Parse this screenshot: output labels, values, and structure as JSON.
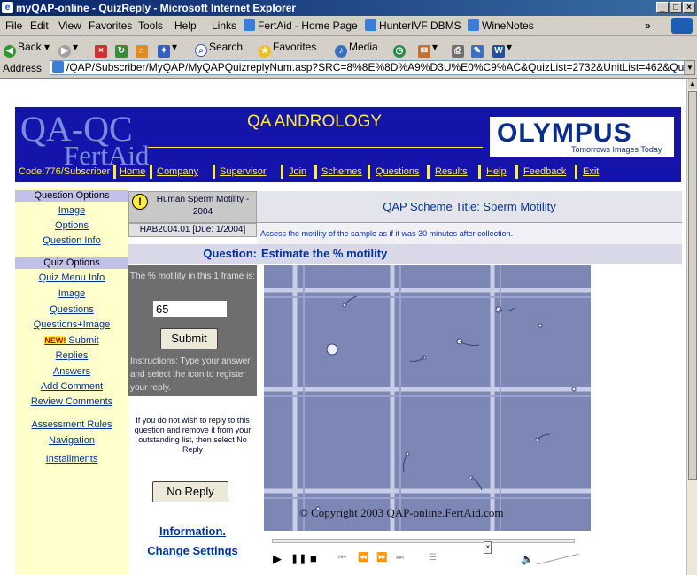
{
  "window": {
    "title": "myQAP-online - QuizReply - Microsoft Internet Explorer",
    "buttons": [
      "_",
      "□",
      "×"
    ]
  },
  "menu": {
    "items": [
      "File",
      "Edit",
      "View",
      "Favorites",
      "Tools",
      "Help"
    ],
    "links_label": "Links",
    "links": [
      "FertAid - Home Page",
      "HunterIVF DBMS",
      "WineNotes"
    ],
    "chevron": "»"
  },
  "toolbar": {
    "back": "Back",
    "search": "Search",
    "favorites": "Favorites",
    "media": "Media"
  },
  "address": {
    "label": "Address",
    "url": "/QAP/Subscriber/MyQAP/MyQAPQuizreplyNum.asp?SRC=8%8E%8D%A9%D3U%E0%C9%AC&QuizList=2732&UnitList=462&QuestList=56"
  },
  "header": {
    "logo_top": "QA-QC",
    "logo_bottom": "FertAid",
    "title": "QA ANDROLOGY",
    "sponsor_name": "OLYMPUS",
    "sponsor_tagline": "Tomorrows Images Today",
    "code": "Code:776/Subscriber",
    "nav": [
      "Home",
      "Company",
      "Supervisor",
      "Join",
      "Schemes",
      "Questions",
      "Results",
      "Help",
      "Feedback",
      "Exit"
    ]
  },
  "sidebar": {
    "question_options_header": "Question Options",
    "question_options": [
      "Image",
      "Options",
      "Question Info"
    ],
    "quiz_options_header": "Quiz Options",
    "quiz_options": [
      "Quiz Menu Info",
      "Image",
      "Questions",
      "Questions+Image"
    ],
    "new_badge": "NEW!",
    "quiz_options_2": [
      "Submit",
      "Replies",
      "Answers",
      "Add Comment",
      "Review Comments"
    ],
    "bottom_links": [
      "Assessment Rules",
      "Navigation",
      "Installments"
    ]
  },
  "question": {
    "topic": "Human Sperm Motility - 2004",
    "ref": "HAB2004.01 [Due: 1/2004]",
    "scheme_title": "QAP Scheme Title: Sperm Motility",
    "instruction": "Assess the motility of the sample as if it was 30 minutes after collection.",
    "label": "Question:",
    "text": "Estimate the % motility"
  },
  "answer": {
    "prompt": "The % motility in this 1 frame is:",
    "value": "65",
    "submit_label": "Submit",
    "instructions": "Instructions: Type your answer and select the icon to register your reply."
  },
  "noreply": {
    "text": "If you do not wish to reply to this question and remove it from your outstanding list, then select No Reply",
    "button": "No Reply"
  },
  "links": {
    "information": "Information.",
    "change_settings": "Change Settings"
  },
  "image": {
    "copyright": "© Copyright 2003  QAP-online.FertAid.com"
  },
  "player": {
    "seek_fraction": 0.72,
    "play": "▶",
    "pause": "❚❚",
    "stop": "■"
  }
}
